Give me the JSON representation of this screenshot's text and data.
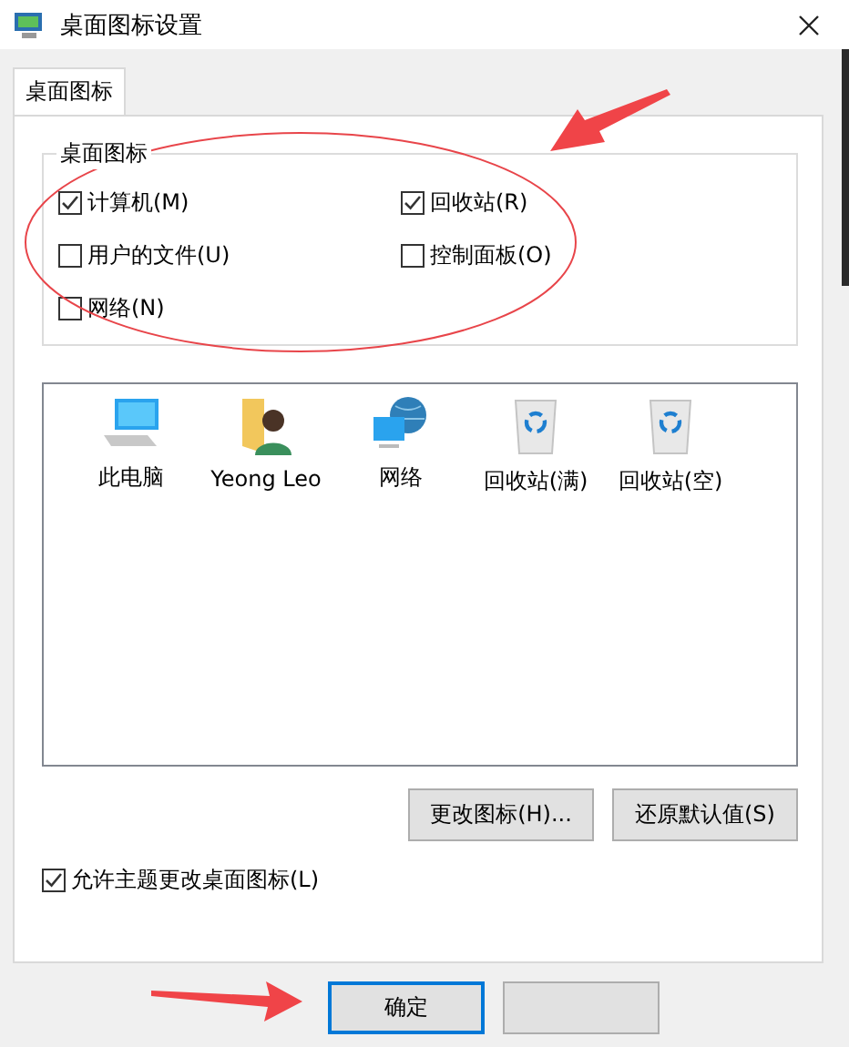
{
  "window": {
    "title": "桌面图标设置"
  },
  "tabs": [
    {
      "label": "桌面图标",
      "selected": true
    }
  ],
  "group": {
    "title": "桌面图标",
    "checkboxes": [
      {
        "label": "计算机(M)",
        "checked": true
      },
      {
        "label": "回收站(R)",
        "checked": true
      },
      {
        "label": "用户的文件(U)",
        "checked": false
      },
      {
        "label": "控制面板(O)",
        "checked": false
      },
      {
        "label": "网络(N)",
        "checked": false
      }
    ]
  },
  "icons": [
    {
      "label": "此电脑",
      "kind": "computer"
    },
    {
      "label": "Yeong Leo",
      "kind": "user"
    },
    {
      "label": "网络",
      "kind": "network"
    },
    {
      "label": "回收站(满)",
      "kind": "bin"
    },
    {
      "label": "回收站(空)",
      "kind": "bin"
    }
  ],
  "icon_buttons": [
    "更改图标(H)...",
    "还原默认值(S)"
  ],
  "theme_checkbox": {
    "label": "允许主题更改桌面图标(L)",
    "checked": true
  },
  "footer": {
    "ok": {
      "label": "确定"
    }
  }
}
